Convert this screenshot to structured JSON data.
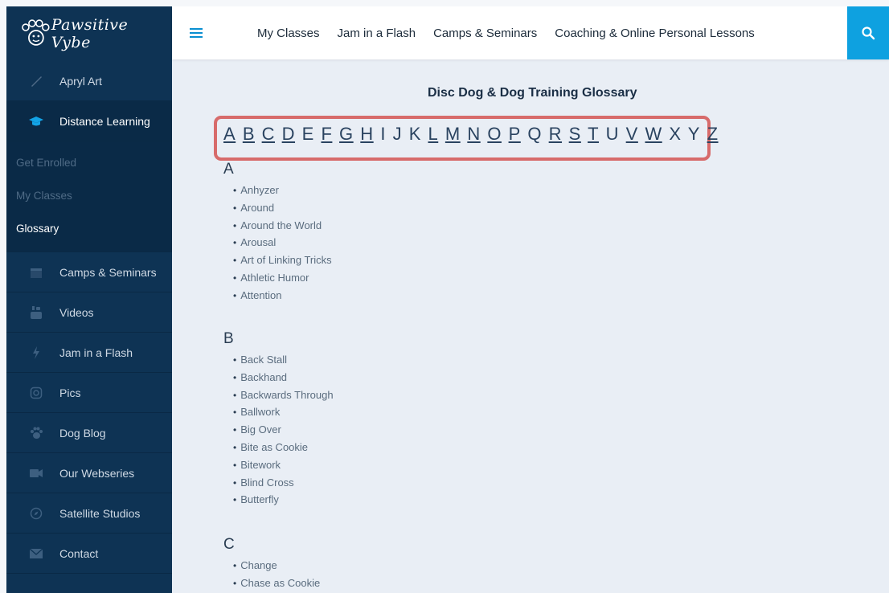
{
  "brand": {
    "logo_text": "Pawsitive Vybe"
  },
  "sidebar": {
    "items": [
      {
        "label": "Apryl Art",
        "icon": "brush-icon"
      },
      {
        "label": "Distance Learning",
        "icon": "graduation-cap-icon"
      }
    ],
    "sub_items": [
      {
        "label": "Get Enrolled"
      },
      {
        "label": "My Classes"
      },
      {
        "label": "Glossary"
      }
    ],
    "more_items": [
      {
        "label": "Camps & Seminars",
        "icon": "calendar-icon"
      },
      {
        "label": "Videos",
        "icon": "youtube-icon"
      },
      {
        "label": "Jam in a Flash",
        "icon": "lightning-icon"
      },
      {
        "label": "Pics",
        "icon": "instagram-icon"
      },
      {
        "label": "Dog Blog",
        "icon": "paw-icon"
      },
      {
        "label": "Our Webseries",
        "icon": "video-camera-icon"
      },
      {
        "label": "Satellite Studios",
        "icon": "compass-icon"
      },
      {
        "label": "Contact",
        "icon": "envelope-icon"
      }
    ]
  },
  "topnav": {
    "links": [
      "My Classes",
      "Jam in a Flash",
      "Camps & Seminars",
      "Coaching & Online Personal Lessons"
    ],
    "search_icon": "search-icon"
  },
  "page": {
    "title": "Disc Dog & Dog Training Glossary",
    "letters": [
      "A",
      "B",
      "C",
      "D",
      "E",
      "F",
      "G",
      "H",
      "I",
      "J",
      "K",
      "L",
      "M",
      "N",
      "O",
      "P",
      "Q",
      "R",
      "S",
      "T",
      "U",
      "V",
      "W",
      "X",
      "Y",
      "Z"
    ],
    "linked_letters": [
      "A",
      "B",
      "C",
      "D",
      "F",
      "G",
      "H",
      "L",
      "M",
      "N",
      "O",
      "P",
      "R",
      "S",
      "T",
      "V",
      "W",
      "Z"
    ],
    "highlight_color": "#d76b6b",
    "sections": [
      {
        "letter": "A",
        "terms": [
          "Anhyzer",
          "Around",
          "Around the World",
          "Arousal",
          "Art of Linking Tricks",
          "Athletic Humor",
          "Attention"
        ]
      },
      {
        "letter": "B",
        "terms": [
          "Back Stall",
          "Backhand",
          "Backwards Through",
          "Ballwork",
          "Big Over",
          "Bite as Cookie",
          "Bitework",
          "Blind Cross",
          "Butterfly"
        ]
      },
      {
        "letter": "C",
        "terms": [
          "Change",
          "Chase as Cookie"
        ]
      }
    ]
  }
}
